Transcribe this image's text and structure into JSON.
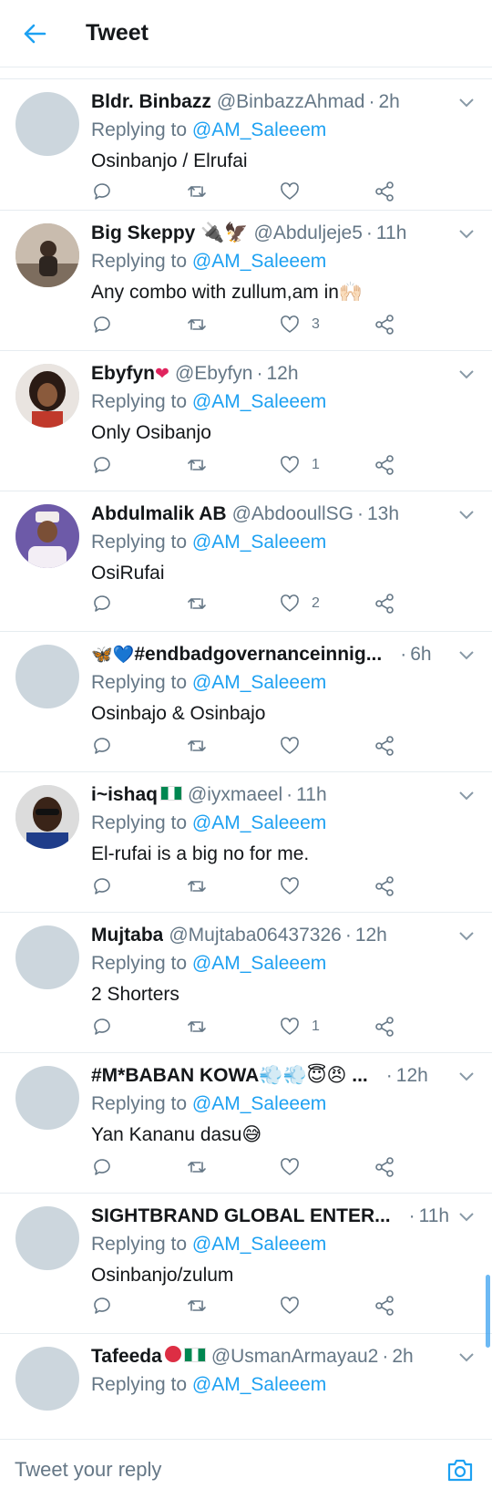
{
  "header": {
    "title": "Tweet"
  },
  "composer": {
    "placeholder": "Tweet your reply"
  },
  "tweets": [
    {
      "name": "Bldr. Binbazz",
      "handle": "@BinbazzAhmad",
      "time": "2h",
      "replying_prefix": "Replying to ",
      "replying_to": "@AM_Saleeem",
      "text": "Osinbanjo / Elrufai",
      "likes": ""
    },
    {
      "name": "Big Skeppy 🔌🦅",
      "handle": "@Abduljeje5",
      "time": "11h",
      "replying_prefix": "Replying to ",
      "replying_to": "@AM_Saleeem",
      "text": "Any combo with zullum,am in🙌🏻",
      "likes": "3"
    },
    {
      "name": "Ebyfyn",
      "name_emoji": "❤",
      "handle": "@Ebyfyn",
      "time": "12h",
      "replying_prefix": "Replying to ",
      "replying_to": "@AM_Saleeem",
      "text": "Only Osibanjo",
      "likes": "1"
    },
    {
      "name": "Abdulmalik AB",
      "handle": "@AbdooullSG",
      "time": "13h",
      "replying_prefix": "Replying to ",
      "replying_to": "@AM_Saleeem",
      "text": "OsiRufai",
      "likes": "2"
    },
    {
      "name_emoji": "🦋",
      "name_emoji2": "💙",
      "name": " #endbadgovernanceinnig...",
      "handle": "",
      "time": "6h",
      "replying_prefix": "Replying to ",
      "replying_to": "@AM_Saleeem",
      "text": "Osinbajo & Osinbajo",
      "likes": ""
    },
    {
      "name": "i~ishaq",
      "handle": "@iyxmaeel",
      "time": "11h",
      "replying_prefix": "Replying to ",
      "replying_to": "@AM_Saleeem",
      "text": "El-rufai is a big no for me.",
      "likes": ""
    },
    {
      "name": "Mujtaba",
      "handle": "@Mujtaba06437326",
      "time": "12h",
      "replying_prefix": "Replying to ",
      "replying_to": "@AM_Saleeem",
      "text": "2 Shorters",
      "likes": "1"
    },
    {
      "name": "#M*BABAN KOWA💨💨😇😠 ...",
      "handle": "",
      "time": "12h",
      "replying_prefix": "Replying to ",
      "replying_to": "@AM_Saleeem",
      "text": "Yan Kananu dasu😅",
      "likes": ""
    },
    {
      "name": "SIGHTBRAND GLOBAL ENTER...",
      "handle": "",
      "time": "11h",
      "replying_prefix": "Replying to ",
      "replying_to": "@AM_Saleeem",
      "text": "Osinbanjo/zulum",
      "likes": ""
    },
    {
      "name": "Tafeeda",
      "handle": "@UsmanArmayau2",
      "time": "2h",
      "replying_prefix": "Replying to ",
      "replying_to": "@AM_Saleeem",
      "text": "",
      "likes": ""
    }
  ],
  "icons": {
    "back": "arrow-left-icon",
    "chevron": "chevron-down-icon",
    "reply": "comment-icon",
    "retweet": "retweet-icon",
    "like": "heart-icon",
    "share": "share-icon",
    "camera": "camera-icon"
  },
  "colors": {
    "accent": "#1da1f2",
    "muted": "#657786",
    "divider": "#e6ecf0"
  }
}
